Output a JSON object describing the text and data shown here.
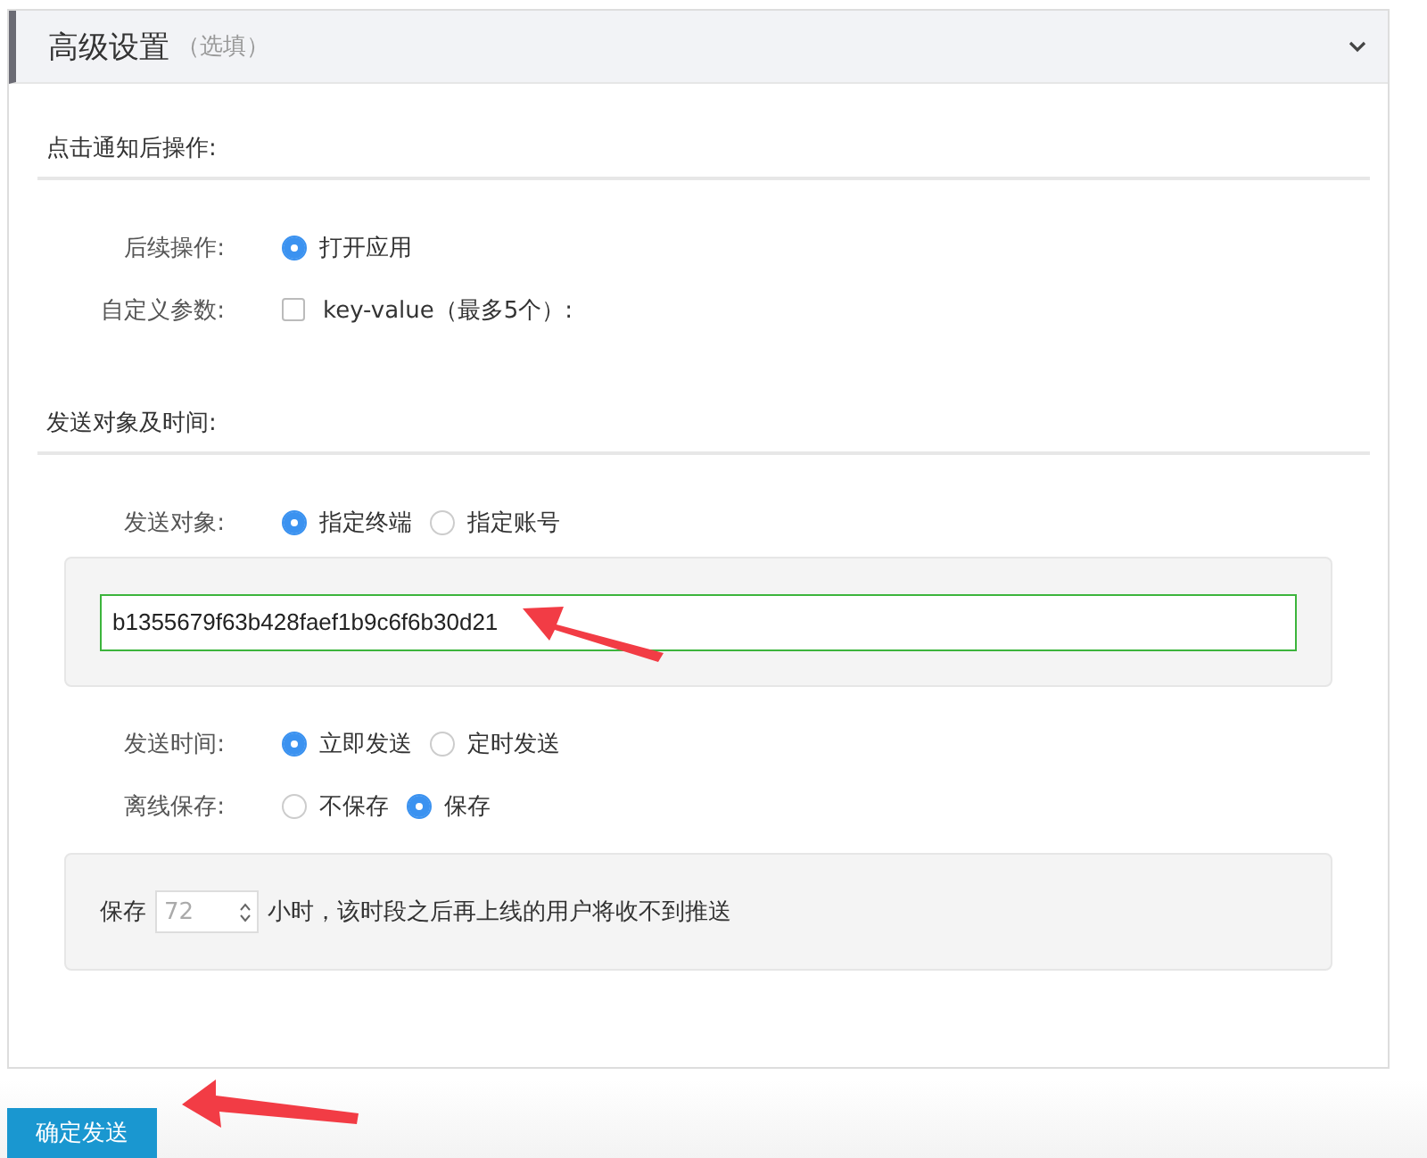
{
  "panel": {
    "title": "高级设置",
    "title_note": "（选填）",
    "expanded": true
  },
  "sections": [
    {
      "title": "点击通知后操作:",
      "rows": [
        {
          "kind": "radio",
          "label": "后续操作:",
          "options": [
            {
              "label": "打开应用",
              "selected": true
            }
          ]
        },
        {
          "kind": "checkbox",
          "label": "自定义参数:",
          "checked": false,
          "text": "key-value（最多5个）:"
        }
      ]
    },
    {
      "title": "发送对象及时间:",
      "rows": [
        {
          "kind": "radio",
          "label": "发送对象:",
          "options": [
            {
              "label": "指定终端",
              "selected": true
            },
            {
              "label": "指定账号",
              "selected": false
            }
          ],
          "box": {
            "kind": "text",
            "value": "b1355679f63b428faef1b9c6f6b30d21"
          }
        },
        {
          "kind": "radio",
          "label": "发送时间:",
          "options": [
            {
              "label": "立即发送",
              "selected": true
            },
            {
              "label": "定时发送",
              "selected": false
            }
          ]
        },
        {
          "kind": "radio",
          "label": "离线保存:",
          "options": [
            {
              "label": "不保存",
              "selected": false
            },
            {
              "label": "保存",
              "selected": true
            }
          ],
          "box": {
            "kind": "hours",
            "prefix": "保存",
            "placeholder": "72",
            "suffix": "小时，该时段之后再上线的用户将收不到推送"
          }
        }
      ]
    }
  ],
  "submit_button": "确定发送"
}
